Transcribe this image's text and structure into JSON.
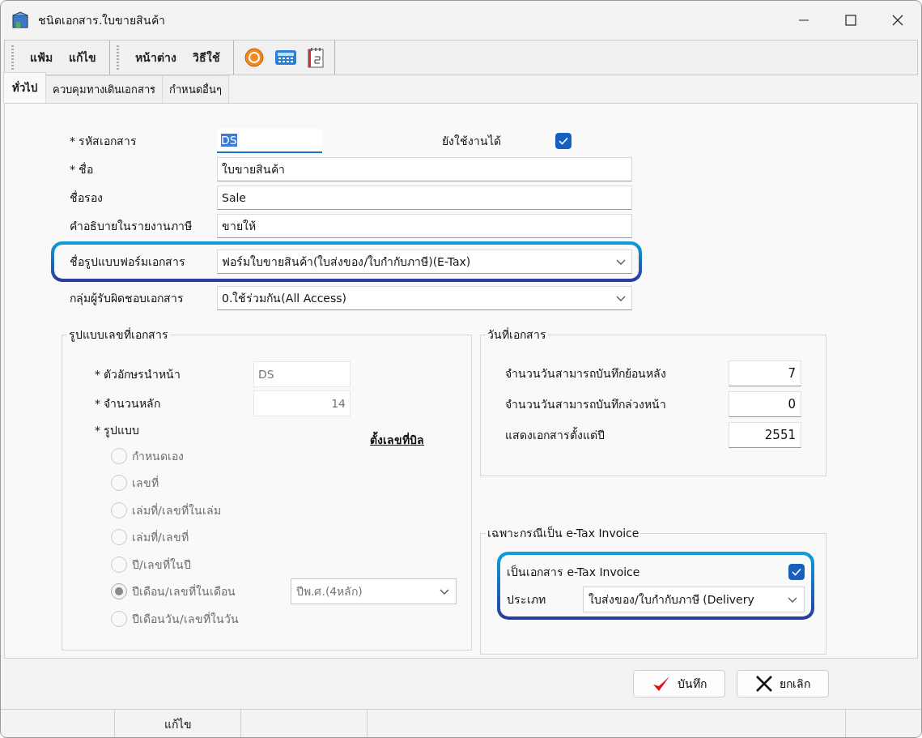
{
  "window": {
    "title": "ชนิดเอกสาร.ใบขายสินค้า"
  },
  "menu_groups": [
    {
      "items": [
        "แฟ้ม",
        "แก้ไข"
      ]
    },
    {
      "items": [
        "หน้าต่าง",
        "วิธีใช้"
      ]
    }
  ],
  "tabs": [
    {
      "label": "ทั่วไป",
      "selected": true
    },
    {
      "label": "ควบคุมทางเดินเอกสาร",
      "selected": false
    },
    {
      "label": "กำหนดอื่นๆ",
      "selected": false
    }
  ],
  "active": {
    "label": "ยังใช้งานได้",
    "checked": true
  },
  "fields": [
    {
      "label": "* รหัสเอกสาร",
      "value": "DS",
      "kind": "code",
      "highlighted": false
    },
    {
      "label": "* ชื่อ",
      "value": "ใบขายสินค้า",
      "kind": "text",
      "highlighted": false
    },
    {
      "label": "ชื่อรอง",
      "value": "Sale",
      "kind": "text",
      "highlighted": false
    },
    {
      "label": "คำอธิบายในรายงานภาษี",
      "value": "ขายให้",
      "kind": "text",
      "highlighted": false
    },
    {
      "label": "ชื่อรูปแบบฟอร์มเอกสาร",
      "value": "ฟอร์มใบขายสินค้า(ใบส่งของ/ใบกำกับภาษี)(E-Tax)",
      "kind": "dropdown",
      "highlighted": true
    },
    {
      "label": "กลุ่มผู้รับผิดชอบเอกสาร",
      "value": "0.ใช้ร่วมกัน(All Access)",
      "kind": "dropdown",
      "highlighted": false
    }
  ],
  "numbering": {
    "title": "รูปแบบเลขที่เอกสาร",
    "fields": [
      {
        "label": "* ตัวอักษรนำหน้า",
        "value": "DS",
        "kind": "text",
        "disabled": true
      },
      {
        "label": "* จำนวนหลัก",
        "value": "14",
        "kind": "number",
        "disabled": true
      }
    ],
    "format_label": "* รูปแบบ",
    "link": "ตั้งเลขที่บิล",
    "options": [
      {
        "label": "กำหนดเอง",
        "selected": false
      },
      {
        "label": "เลขที่",
        "selected": false
      },
      {
        "label": "เล่มที่/เลขที่ในเล่ม",
        "selected": false
      },
      {
        "label": "เล่มที่/เลขที่",
        "selected": false
      },
      {
        "label": "ปี/เลขที่ในปี",
        "selected": false
      },
      {
        "label": "ปีเดือน/เลขที่ในเดือน",
        "selected": true
      },
      {
        "label": "ปีเดือนวัน/เลขที่ในวัน",
        "selected": false
      }
    ],
    "year_format": "ปีพ.ศ.(4หลัก)"
  },
  "dates": {
    "title": "วันที่เอกสาร",
    "fields": [
      {
        "label": "จำนวนวันสามารถบันทึกย้อนหลัง",
        "value": "7"
      },
      {
        "label": "จำนวนวันสามารถบันทึกล่วงหน้า",
        "value": "0"
      },
      {
        "label": "แสดงเอกสารตั้งแต่ปี",
        "value": "2551"
      }
    ]
  },
  "etax": {
    "title": "เฉพาะกรณีเป็น e-Tax Invoice",
    "highlighted": true,
    "checkbox": {
      "label": "เป็นเอกสาร e-Tax Invoice",
      "checked": true
    },
    "type": {
      "label": "ประเภท",
      "value": "ใบส่งของ/ใบกำกับภาษี (Delivery"
    }
  },
  "buttons": [
    {
      "label": "บันทึก",
      "kind": "save"
    },
    {
      "label": "ยกเลิก",
      "kind": "cancel"
    }
  ],
  "status_bar": {
    "mode": "แก้ไข"
  }
}
